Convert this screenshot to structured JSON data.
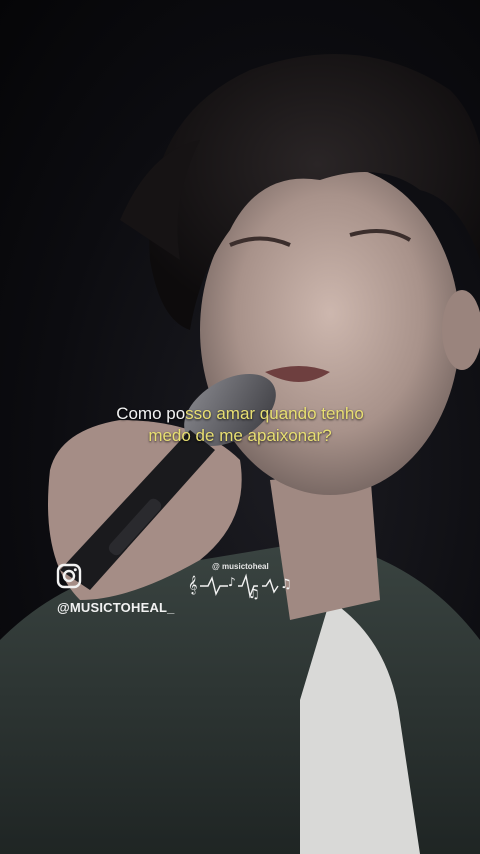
{
  "caption": {
    "line1_a": "Como po",
    "line1_b": "sso amar quando tenho",
    "line2_a": "medo de me ",
    "line2_b": "apaixonar?",
    "highlight_color": "#e8df72"
  },
  "branding": {
    "icon": "instagram-icon",
    "handle": "@MUSICTOHEAL_",
    "watermark_label": "@ musictoheal",
    "watermark_icon": "music-wave-icon"
  }
}
